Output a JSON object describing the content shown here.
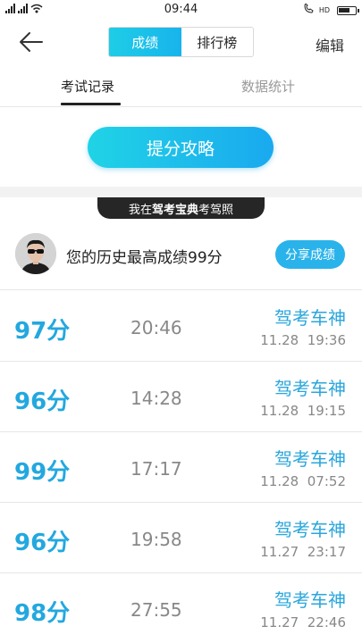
{
  "status_bar": {
    "time": "09:44",
    "hd_label": "HD",
    "battery_fraction": 0.7
  },
  "nav": {
    "segments": [
      "成绩",
      "排行榜"
    ],
    "active_segment": 0,
    "edit_label": "编辑"
  },
  "subtabs": {
    "items": [
      "考试记录",
      "数据统计"
    ],
    "active": 0
  },
  "tip_button_label": "提分攻略",
  "banner": {
    "prefix": "我在",
    "brand": "驾考宝典",
    "suffix": "考驾照"
  },
  "profile": {
    "best_text": "您的历史最高成绩99分",
    "share_label": "分享成绩"
  },
  "records": [
    {
      "score": "97分",
      "duration": "20:46",
      "rank": "驾考车神",
      "date": "11.28",
      "time": "19:36"
    },
    {
      "score": "96分",
      "duration": "14:28",
      "rank": "驾考车神",
      "date": "11.28",
      "time": "19:15"
    },
    {
      "score": "99分",
      "duration": "17:17",
      "rank": "驾考车神",
      "date": "11.28",
      "time": "07:52"
    },
    {
      "score": "96分",
      "duration": "19:58",
      "rank": "驾考车神",
      "date": "11.27",
      "time": "23:17"
    },
    {
      "score": "98分",
      "duration": "27:55",
      "rank": "驾考车神",
      "date": "11.27",
      "time": "22:46"
    }
  ],
  "colors": {
    "accent": "#1ab4ec",
    "score_blue": "#23a8df",
    "banner_bg": "#262626"
  }
}
